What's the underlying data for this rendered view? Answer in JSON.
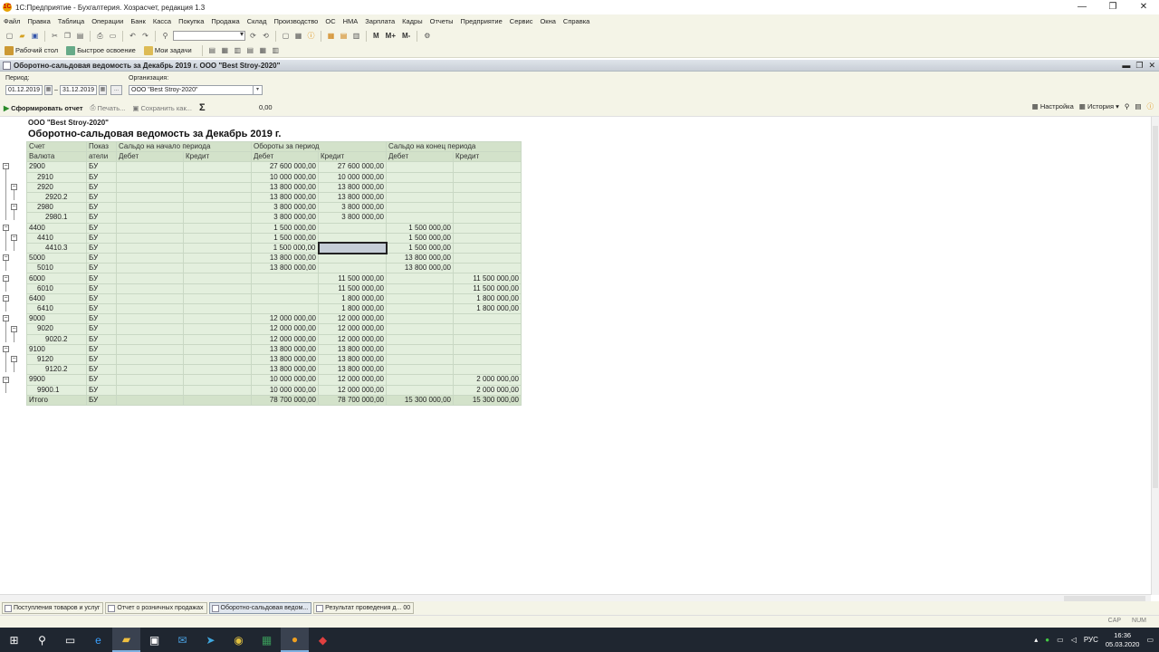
{
  "window": {
    "title": "1С:Предприятие - Бухгалтерия. Хозрасчет, редакция 1.3",
    "app_letter": "1С"
  },
  "window_controls": [
    "—",
    "❐",
    "✕"
  ],
  "menu": [
    "Файл",
    "Правка",
    "Таблица",
    "Операции",
    "Банк",
    "Касса",
    "Покупка",
    "Продажа",
    "Склад",
    "Производство",
    "ОС",
    "НМА",
    "Зарплата",
    "Кадры",
    "Отчеты",
    "Предприятие",
    "Сервис",
    "Окна",
    "Справка"
  ],
  "toolbar1": {
    "m_labels": [
      "M",
      "M+",
      "M-"
    ]
  },
  "toolbar2": {
    "desktop": "Рабочий стол",
    "quick": "Быстрое освоение",
    "tasks": "Мои задачи"
  },
  "subwindow": {
    "title": "Оборотно-сальдовая ведомость за Декабрь 2019 г. ООО \"Best Stroy-2020\""
  },
  "form": {
    "period_label": "Период:",
    "date_from": "01.12.2019",
    "date_to": "31.12.2019",
    "dash": "–",
    "dots": "...",
    "org_label": "Организация:",
    "org_value": "ООО \"Best Stroy-2020\""
  },
  "commands": {
    "generate": "Сформировать отчет",
    "print": "Печать...",
    "save": "Сохранить как...",
    "sum_value": "0,00",
    "settings": "Настройка",
    "history": "История"
  },
  "report": {
    "org": "ООО \"Best Stroy-2020\"",
    "title": "Оборотно-сальдовая ведомость за Декабрь 2019 г.",
    "headers": {
      "account": "Счет",
      "indicator1": "Показ",
      "indicator2": "атели",
      "currency": "Валюта",
      "opening": "Сальдо на начало периода",
      "turnover": "Обороты за период",
      "closing": "Сальдо на конец периода",
      "debit": "Дебет",
      "credit": "Кредит"
    },
    "rows": [
      {
        "acc": "2900",
        "lvl": 0,
        "ind": "БУ",
        "od": "",
        "oc": "",
        "td": "27 600 000,00",
        "tc": "27 600 000,00",
        "cd": "",
        "cc": ""
      },
      {
        "acc": "2910",
        "lvl": 1,
        "ind": "БУ",
        "od": "",
        "oc": "",
        "td": "10 000 000,00",
        "tc": "10 000 000,00",
        "cd": "",
        "cc": ""
      },
      {
        "acc": "2920",
        "lvl": 1,
        "ind": "БУ",
        "od": "",
        "oc": "",
        "td": "13 800 000,00",
        "tc": "13 800 000,00",
        "cd": "",
        "cc": ""
      },
      {
        "acc": "2920.2",
        "lvl": 2,
        "ind": "БУ",
        "od": "",
        "oc": "",
        "td": "13 800 000,00",
        "tc": "13 800 000,00",
        "cd": "",
        "cc": ""
      },
      {
        "acc": "2980",
        "lvl": 1,
        "ind": "БУ",
        "od": "",
        "oc": "",
        "td": "3 800 000,00",
        "tc": "3 800 000,00",
        "cd": "",
        "cc": ""
      },
      {
        "acc": "2980.1",
        "lvl": 2,
        "ind": "БУ",
        "od": "",
        "oc": "",
        "td": "3 800 000,00",
        "tc": "3 800 000,00",
        "cd": "",
        "cc": ""
      },
      {
        "acc": "4400",
        "lvl": 0,
        "ind": "БУ",
        "od": "",
        "oc": "",
        "td": "1 500 000,00",
        "tc": "",
        "cd": "1 500 000,00",
        "cc": ""
      },
      {
        "acc": "4410",
        "lvl": 1,
        "ind": "БУ",
        "od": "",
        "oc": "",
        "td": "1 500 000,00",
        "tc": "",
        "cd": "1 500 000,00",
        "cc": ""
      },
      {
        "acc": "4410.3",
        "lvl": 2,
        "ind": "БУ",
        "od": "",
        "oc": "",
        "td": "1 500 000,00",
        "tc": "",
        "cd": "1 500 000,00",
        "cc": "",
        "sel": true
      },
      {
        "acc": "5000",
        "lvl": 0,
        "ind": "БУ",
        "od": "",
        "oc": "",
        "td": "13 800 000,00",
        "tc": "",
        "cd": "13 800 000,00",
        "cc": ""
      },
      {
        "acc": "5010",
        "lvl": 1,
        "ind": "БУ",
        "od": "",
        "oc": "",
        "td": "13 800 000,00",
        "tc": "",
        "cd": "13 800 000,00",
        "cc": ""
      },
      {
        "acc": "6000",
        "lvl": 0,
        "ind": "БУ",
        "od": "",
        "oc": "",
        "td": "",
        "tc": "11 500 000,00",
        "cd": "",
        "cc": "11 500 000,00"
      },
      {
        "acc": "6010",
        "lvl": 1,
        "ind": "БУ",
        "od": "",
        "oc": "",
        "td": "",
        "tc": "11 500 000,00",
        "cd": "",
        "cc": "11 500 000,00"
      },
      {
        "acc": "6400",
        "lvl": 0,
        "ind": "БУ",
        "od": "",
        "oc": "",
        "td": "",
        "tc": "1 800 000,00",
        "cd": "",
        "cc": "1 800 000,00"
      },
      {
        "acc": "6410",
        "lvl": 1,
        "ind": "БУ",
        "od": "",
        "oc": "",
        "td": "",
        "tc": "1 800 000,00",
        "cd": "",
        "cc": "1 800 000,00"
      },
      {
        "acc": "9000",
        "lvl": 0,
        "ind": "БУ",
        "od": "",
        "oc": "",
        "td": "12 000 000,00",
        "tc": "12 000 000,00",
        "cd": "",
        "cc": ""
      },
      {
        "acc": "9020",
        "lvl": 1,
        "ind": "БУ",
        "od": "",
        "oc": "",
        "td": "12 000 000,00",
        "tc": "12 000 000,00",
        "cd": "",
        "cc": ""
      },
      {
        "acc": "9020.2",
        "lvl": 2,
        "ind": "БУ",
        "od": "",
        "oc": "",
        "td": "12 000 000,00",
        "tc": "12 000 000,00",
        "cd": "",
        "cc": ""
      },
      {
        "acc": "9100",
        "lvl": 0,
        "ind": "БУ",
        "od": "",
        "oc": "",
        "td": "13 800 000,00",
        "tc": "13 800 000,00",
        "cd": "",
        "cc": ""
      },
      {
        "acc": "9120",
        "lvl": 1,
        "ind": "БУ",
        "od": "",
        "oc": "",
        "td": "13 800 000,00",
        "tc": "13 800 000,00",
        "cd": "",
        "cc": ""
      },
      {
        "acc": "9120.2",
        "lvl": 2,
        "ind": "БУ",
        "od": "",
        "oc": "",
        "td": "13 800 000,00",
        "tc": "13 800 000,00",
        "cd": "",
        "cc": ""
      },
      {
        "acc": "9900",
        "lvl": 0,
        "ind": "БУ",
        "od": "",
        "oc": "",
        "td": "10 000 000,00",
        "tc": "12 000 000,00",
        "cd": "",
        "cc": "2 000 000,00"
      },
      {
        "acc": "9900.1",
        "lvl": 1,
        "ind": "БУ",
        "od": "",
        "oc": "",
        "td": "10 000 000,00",
        "tc": "12 000 000,00",
        "cd": "",
        "cc": "2 000 000,00"
      }
    ],
    "total": {
      "acc": "Итого",
      "ind": "БУ",
      "od": "",
      "oc": "",
      "td": "78 700 000,00",
      "tc": "78 700 000,00",
      "cd": "15 300 000,00",
      "cc": "15 300 000,00"
    }
  },
  "open_windows": [
    {
      "label": "Поступления товаров и услуг",
      "active": false
    },
    {
      "label": "Отчет о розничных продажах",
      "active": false
    },
    {
      "label": "Оборотно-сальдовая ведом...",
      "active": true
    },
    {
      "label": "Результат проведения д...",
      "active": false
    }
  ],
  "open_windows_extra": "00",
  "status": {
    "caps": "CAP",
    "num": "NUM"
  },
  "taskbar": {
    "lang": "РУС",
    "time": "16:36",
    "date": "05.03.2020"
  }
}
